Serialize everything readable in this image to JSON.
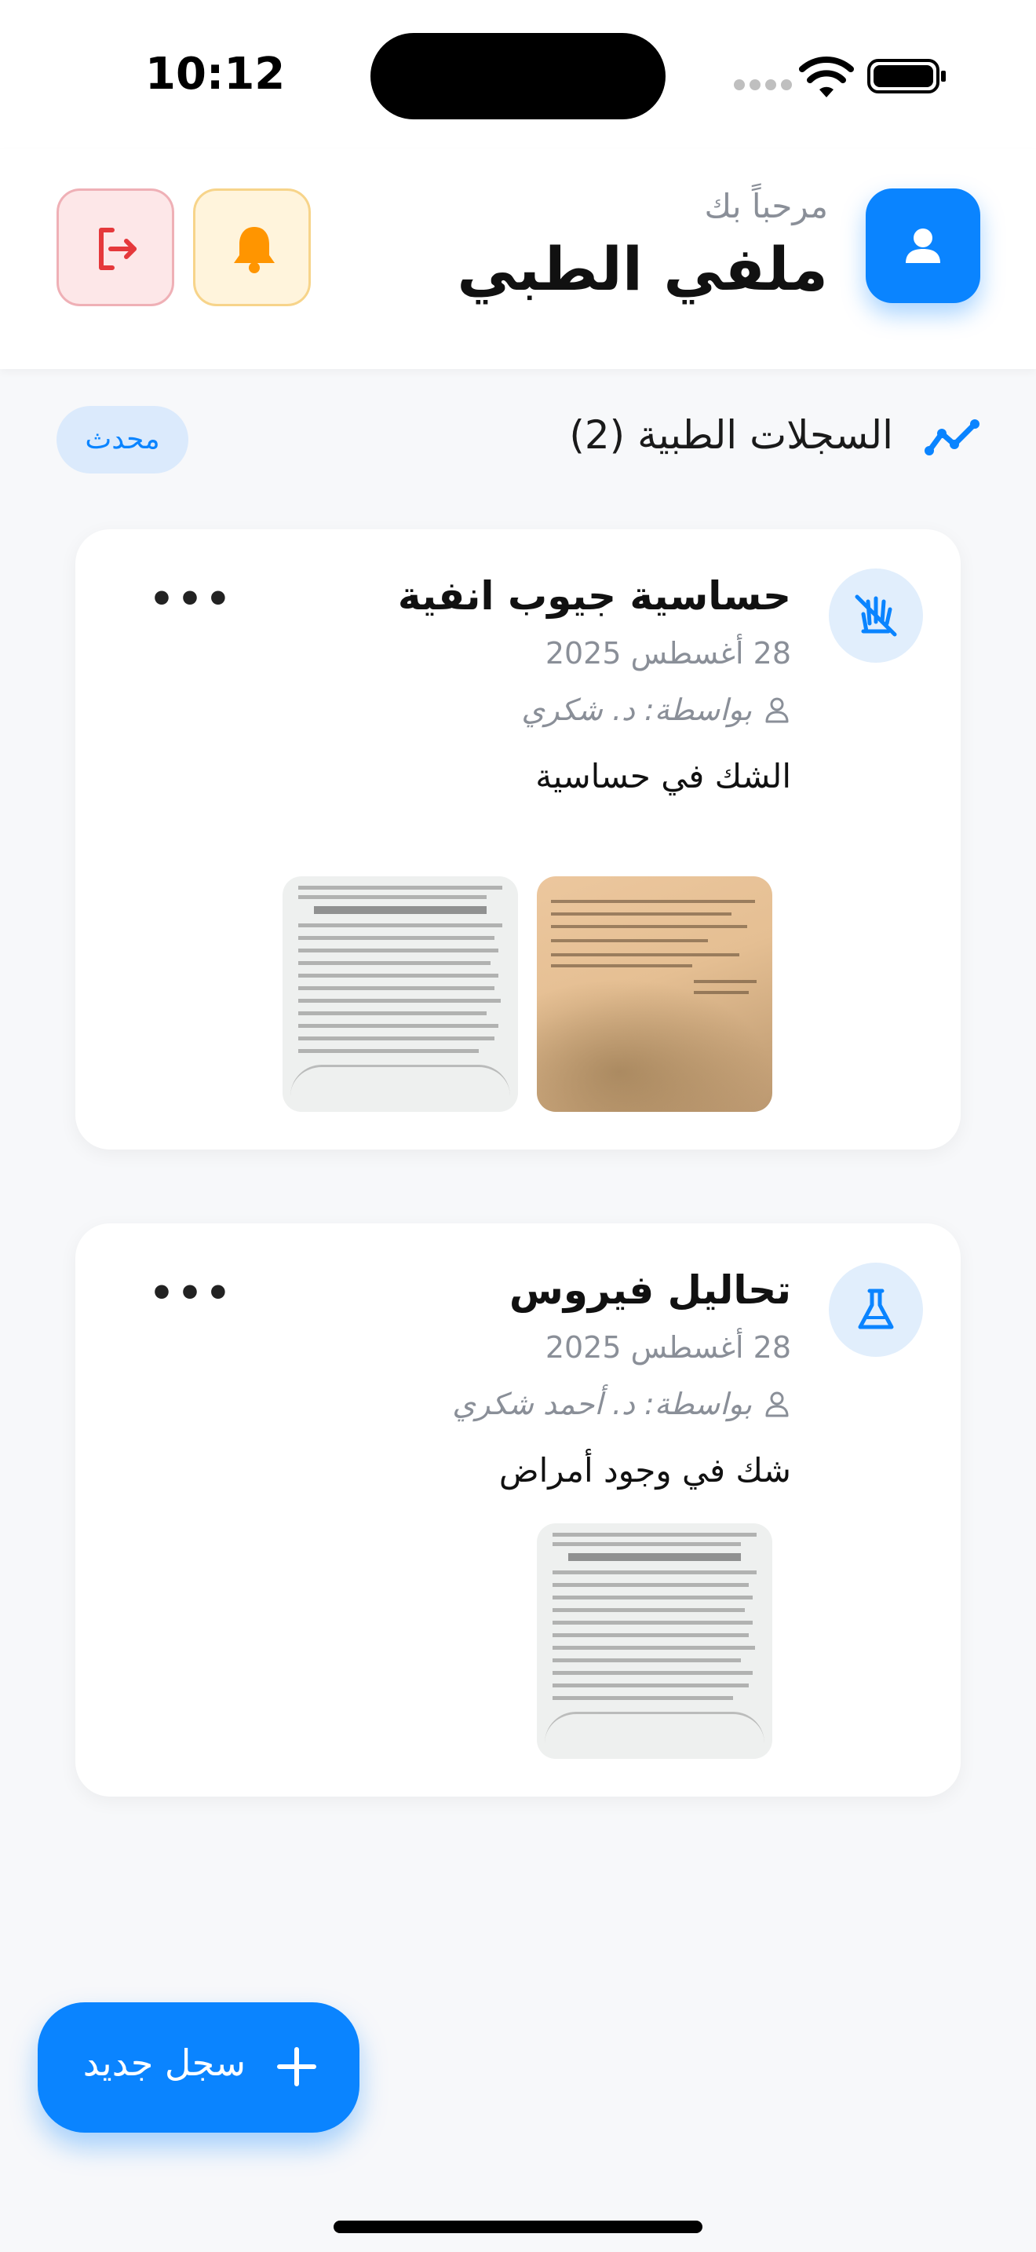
{
  "status_bar": {
    "time": "10:12"
  },
  "header": {
    "greeting": "مرحباً بك",
    "title": "ملفي الطبي",
    "icons": {
      "profile": "person-icon",
      "notifications": "bell-icon",
      "logout": "logout-icon"
    }
  },
  "records_section": {
    "title": "السجلات الطبية (2)",
    "badge": "محدث",
    "icon": "trend-icon"
  },
  "records": [
    {
      "title": "حساسية جيوب انفية",
      "date": "28 أغسطس 2025",
      "doctor": "بواسطة: د. شكري",
      "note": "الشك في حساسية",
      "type_icon": "hand-allergy-icon",
      "attachments": 2
    },
    {
      "title": "تحاليل فيروس",
      "date": "28 أغسطس 2025",
      "doctor": "بواسطة: د. أحمد شكري",
      "note": "شك في وجود أمراض",
      "type_icon": "flask-icon",
      "attachments": 1
    }
  ],
  "fab": {
    "label": "سجل جديد",
    "icon": "plus-icon"
  },
  "colors": {
    "accent": "#0a84ff",
    "notif_bg": "#fff4dc",
    "logout_bg": "#fde7e8",
    "badge_bg": "#dbeafc"
  }
}
